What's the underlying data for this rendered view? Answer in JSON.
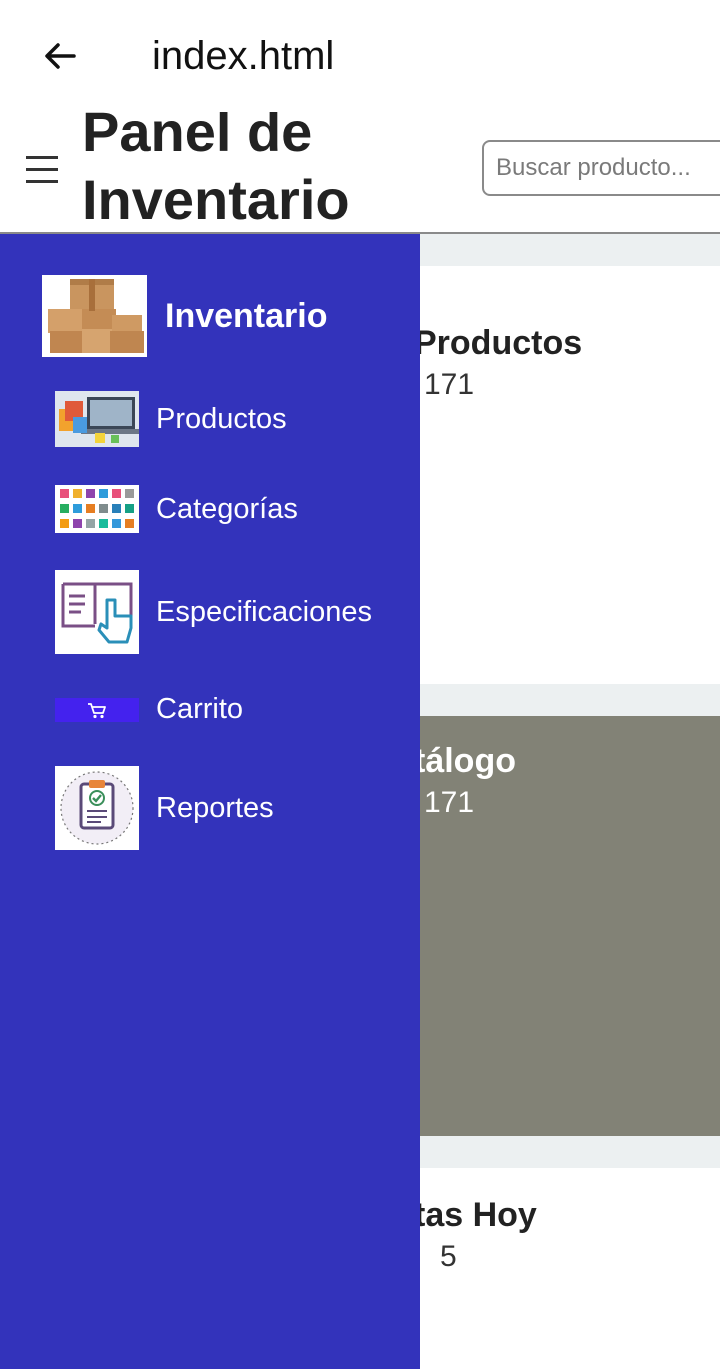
{
  "browser": {
    "title": "index.html"
  },
  "header": {
    "title": "Panel de Inventario",
    "search_placeholder": "Buscar producto..."
  },
  "cards": [
    {
      "title": "Productos",
      "value": "171"
    },
    {
      "title": "tálogo",
      "value": "171"
    },
    {
      "title": "tas Hoy",
      "value": "5"
    }
  ],
  "drawer": {
    "brand": "Inventario",
    "items": [
      {
        "label": "Productos",
        "icon": "shopping-laptop-icon"
      },
      {
        "label": "Categorías",
        "icon": "categories-grid-icon"
      },
      {
        "label": "Especificaciones",
        "icon": "touch-document-icon"
      },
      {
        "label": "Carrito",
        "icon": "cart-icon"
      },
      {
        "label": "Reportes",
        "icon": "clipboard-check-icon"
      }
    ]
  },
  "colors": {
    "drawer_bg": "#3333bb",
    "content_bg": "#ecf0f1",
    "catalog_card_bg": "#828276"
  }
}
